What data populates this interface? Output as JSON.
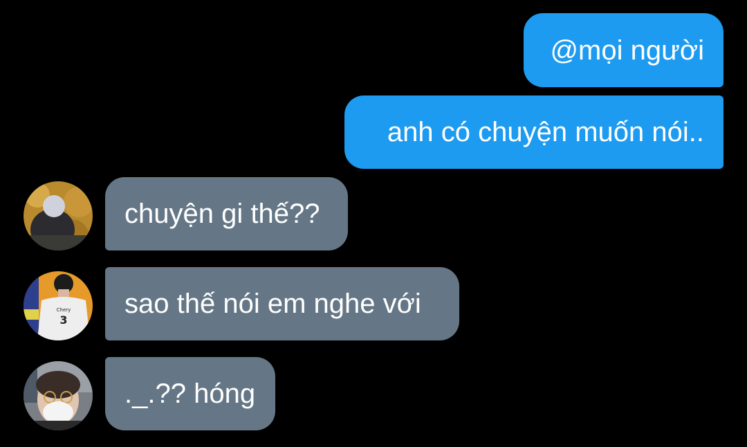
{
  "messages": [
    {
      "direction": "outgoing",
      "text": "@mọi người"
    },
    {
      "direction": "outgoing",
      "text": "anh có chuyện muốn nói.."
    },
    {
      "direction": "incoming",
      "text": "chuyện gi thế??",
      "avatar": "avatar-hooded-person"
    },
    {
      "direction": "incoming",
      "text": "sao thế nói em nghe với",
      "avatar": "avatar-jersey-back",
      "avatar_text": {
        "name": "Chery",
        "number": "3"
      }
    },
    {
      "direction": "incoming",
      "text": "._.?? hóng",
      "avatar": "avatar-masked-person"
    }
  ],
  "colors": {
    "background": "#000000",
    "outgoing_bubble": "#1d9bf0",
    "incoming_bubble": "#657786",
    "text": "#ffffff"
  }
}
